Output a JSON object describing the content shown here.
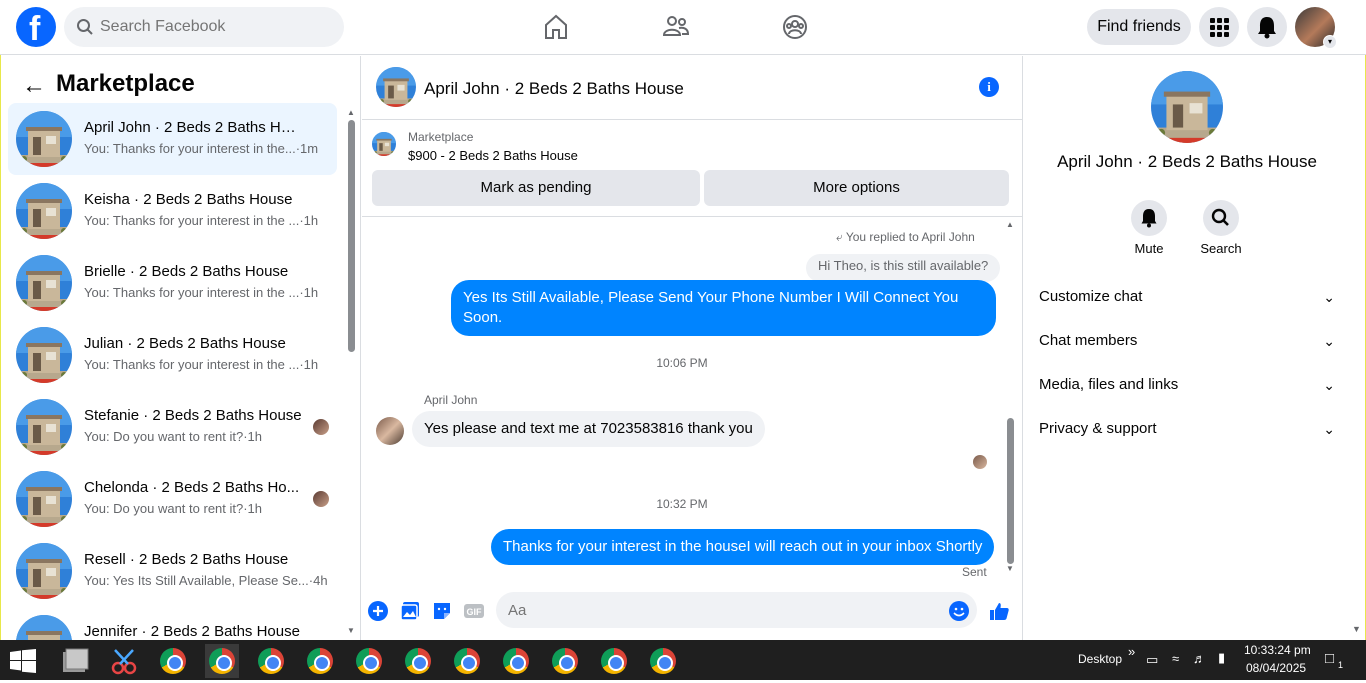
{
  "topbar": {
    "logo": "f",
    "search_placeholder": "Search Facebook",
    "find_friends": "Find friends"
  },
  "left": {
    "title": "Marketplace",
    "conversations": [
      {
        "name": "April John · 2 Beds 2 Baths House",
        "preview": "You: Thanks for your interest in the...·1m",
        "active": true
      },
      {
        "name": "Keisha · 2 Beds 2 Baths House",
        "preview": "You: Thanks for your interest in the ...·1h"
      },
      {
        "name": "Brielle · 2 Beds 2 Baths House",
        "preview": "You: Thanks for your interest in the ...·1h"
      },
      {
        "name": "Julian · 2 Beds 2 Baths House",
        "preview": "You: Thanks for your interest in the ...·1h"
      },
      {
        "name": "Stefanie · 2 Beds 2 Baths House",
        "preview": "You: Do you want to rent it?·1h"
      },
      {
        "name": "Chelonda · 2 Beds 2 Baths Ho...",
        "preview": "You: Do you want to rent it?·1h"
      },
      {
        "name": "Resell · 2 Beds 2 Baths House",
        "preview": "You: Yes Its Still Available, Please Se...·4h"
      },
      {
        "name": "Jennifer · 2 Beds 2 Baths House",
        "preview": ""
      }
    ]
  },
  "chat": {
    "title": "April John · 2 Beds 2 Baths House",
    "marketplace_label": "Marketplace",
    "listing": "$900 - 2 Beds 2 Baths House",
    "mark_pending": "Mark as pending",
    "more_options": "More options",
    "replied_to": "You replied to April John",
    "quoted": "Hi Theo, is this still available?",
    "msg1": "Yes Its Still Available, Please Send Your Phone Number I Will Connect You Soon.",
    "time1": "10:06 PM",
    "sender": "April John",
    "msg2": "Yes please and text me at 7023583816 thank you",
    "time2": "10:32 PM",
    "msg3": "Thanks for your interest in the houseI will reach out in your inbox Shortly",
    "status": "Sent",
    "input_placeholder": "Aa"
  },
  "right": {
    "name": "April John · 2 Beds 2 Baths House",
    "mute": "Mute",
    "search": "Search",
    "rows": [
      "Customize chat",
      "Chat members",
      "Media, files and links",
      "Privacy & support"
    ]
  },
  "taskbar": {
    "desktop": "Desktop",
    "time": "10:33:24 pm",
    "date": "08/04/2025",
    "notif_count": "1"
  },
  "colors": {
    "brand": "#0866ff",
    "bubble_out": "#0084ff",
    "bubble_in": "#f0f2f5"
  }
}
